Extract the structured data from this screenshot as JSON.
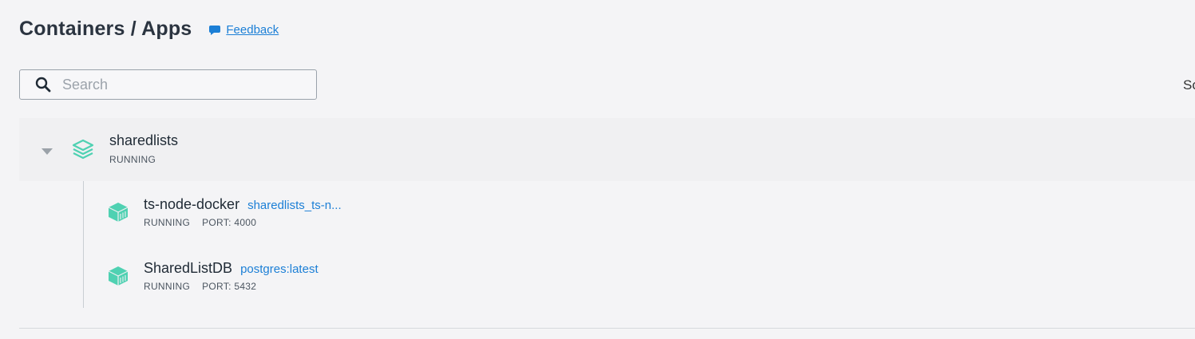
{
  "header": {
    "title": "Containers / Apps",
    "feedback_label": "Feedback"
  },
  "search": {
    "placeholder": "Search",
    "value": ""
  },
  "toolbar": {
    "sort_label_clipped": "So"
  },
  "app": {
    "name": "sharedlists",
    "status": "RUNNING",
    "containers": [
      {
        "name": "ts-node-docker",
        "image": "sharedlists_ts-n...",
        "status": "RUNNING",
        "port": "PORT: 4000"
      },
      {
        "name": "SharedListDB",
        "image": "postgres:latest",
        "status": "RUNNING",
        "port": "PORT: 5432"
      }
    ]
  },
  "colors": {
    "accent": "#1c7fd6",
    "running_teal": "#4fd1b2"
  },
  "icons": [
    "search-icon",
    "chat-bubble-icon",
    "chevron-down-icon",
    "stack-icon",
    "container-cube-icon"
  ]
}
